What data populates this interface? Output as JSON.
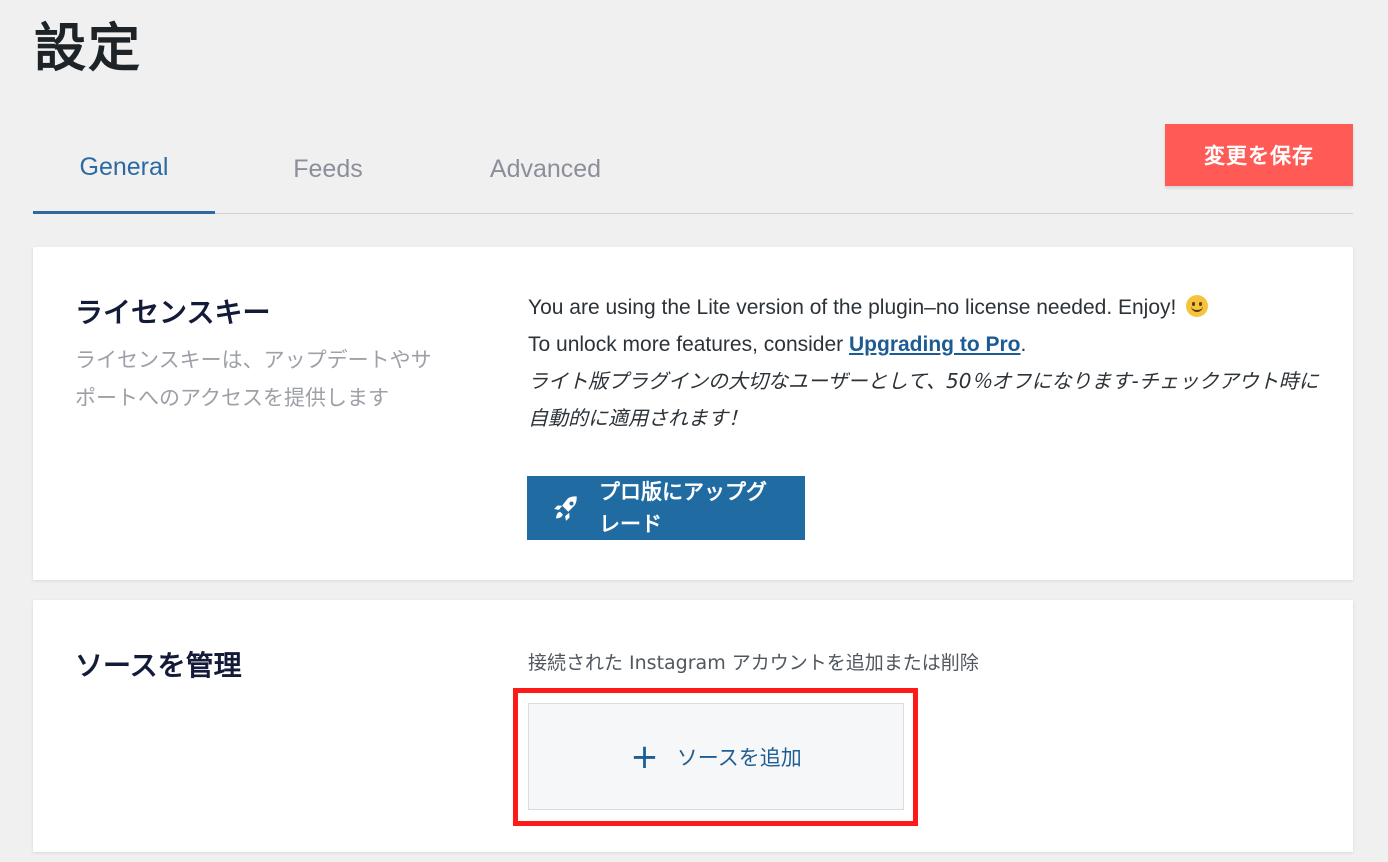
{
  "page": {
    "title": "設定"
  },
  "tabs": [
    {
      "label": "General",
      "active": true
    },
    {
      "label": "Feeds",
      "active": false
    },
    {
      "label": "Advanced",
      "active": false
    }
  ],
  "toolbar": {
    "save_label": "変更を保存"
  },
  "license": {
    "heading": "ライセンスキー",
    "description": "ライセンスキーは、アップデートやサポートへのアクセスを提供します",
    "lite_notice": "You are using the Lite version of the plugin–no license needed. Enjoy!",
    "unlock_prefix": "To unlock more features, consider ",
    "upgrade_link": "Upgrading to Pro",
    "unlock_suffix": ".",
    "promo": "ライト版プラグインの大切なユーザーとして、50％オフになります-チェックアウト時に自動的に適用されます！",
    "pro_button_label": "プロ版にアップグレード"
  },
  "sources": {
    "heading": "ソースを管理",
    "subtitle": "接続された Instagram アカウントを追加または削除",
    "add_button_label": "ソースを追加"
  },
  "colors": {
    "save_button": "#ff5a55",
    "pro_button": "#1f6ba2",
    "active_tab": "#2c6aa0",
    "highlight": "#ff1a1a"
  },
  "icons": {
    "smile": "slightly-smiling-face-icon",
    "rocket": "rocket-icon",
    "plus": "plus-icon"
  }
}
